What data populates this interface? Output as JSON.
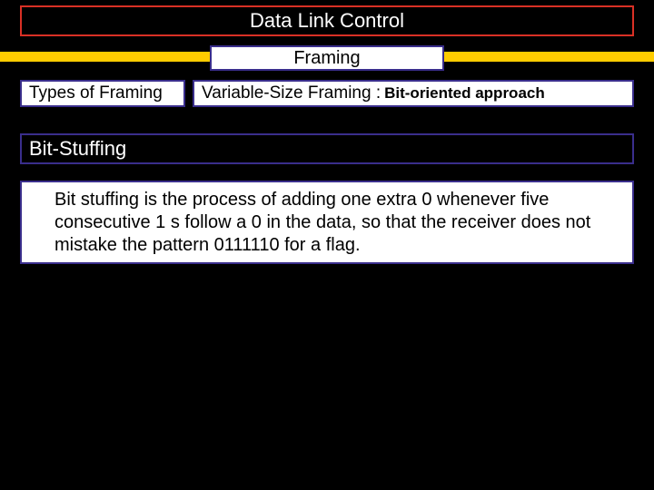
{
  "title": "Data Link Control",
  "subtitle": "Framing",
  "types_label": "Types of  Framing",
  "variable_prefix": "Variable-Size Framing :",
  "variable_bold": "Bit-oriented approach",
  "section_header": "Bit-Stuffing",
  "body": "Bit stuffing is the process of adding one extra 0 whenever five consecutive 1 s follow a 0 in the data, so that the receiver does not mistake the pattern 0111110 for a flag."
}
